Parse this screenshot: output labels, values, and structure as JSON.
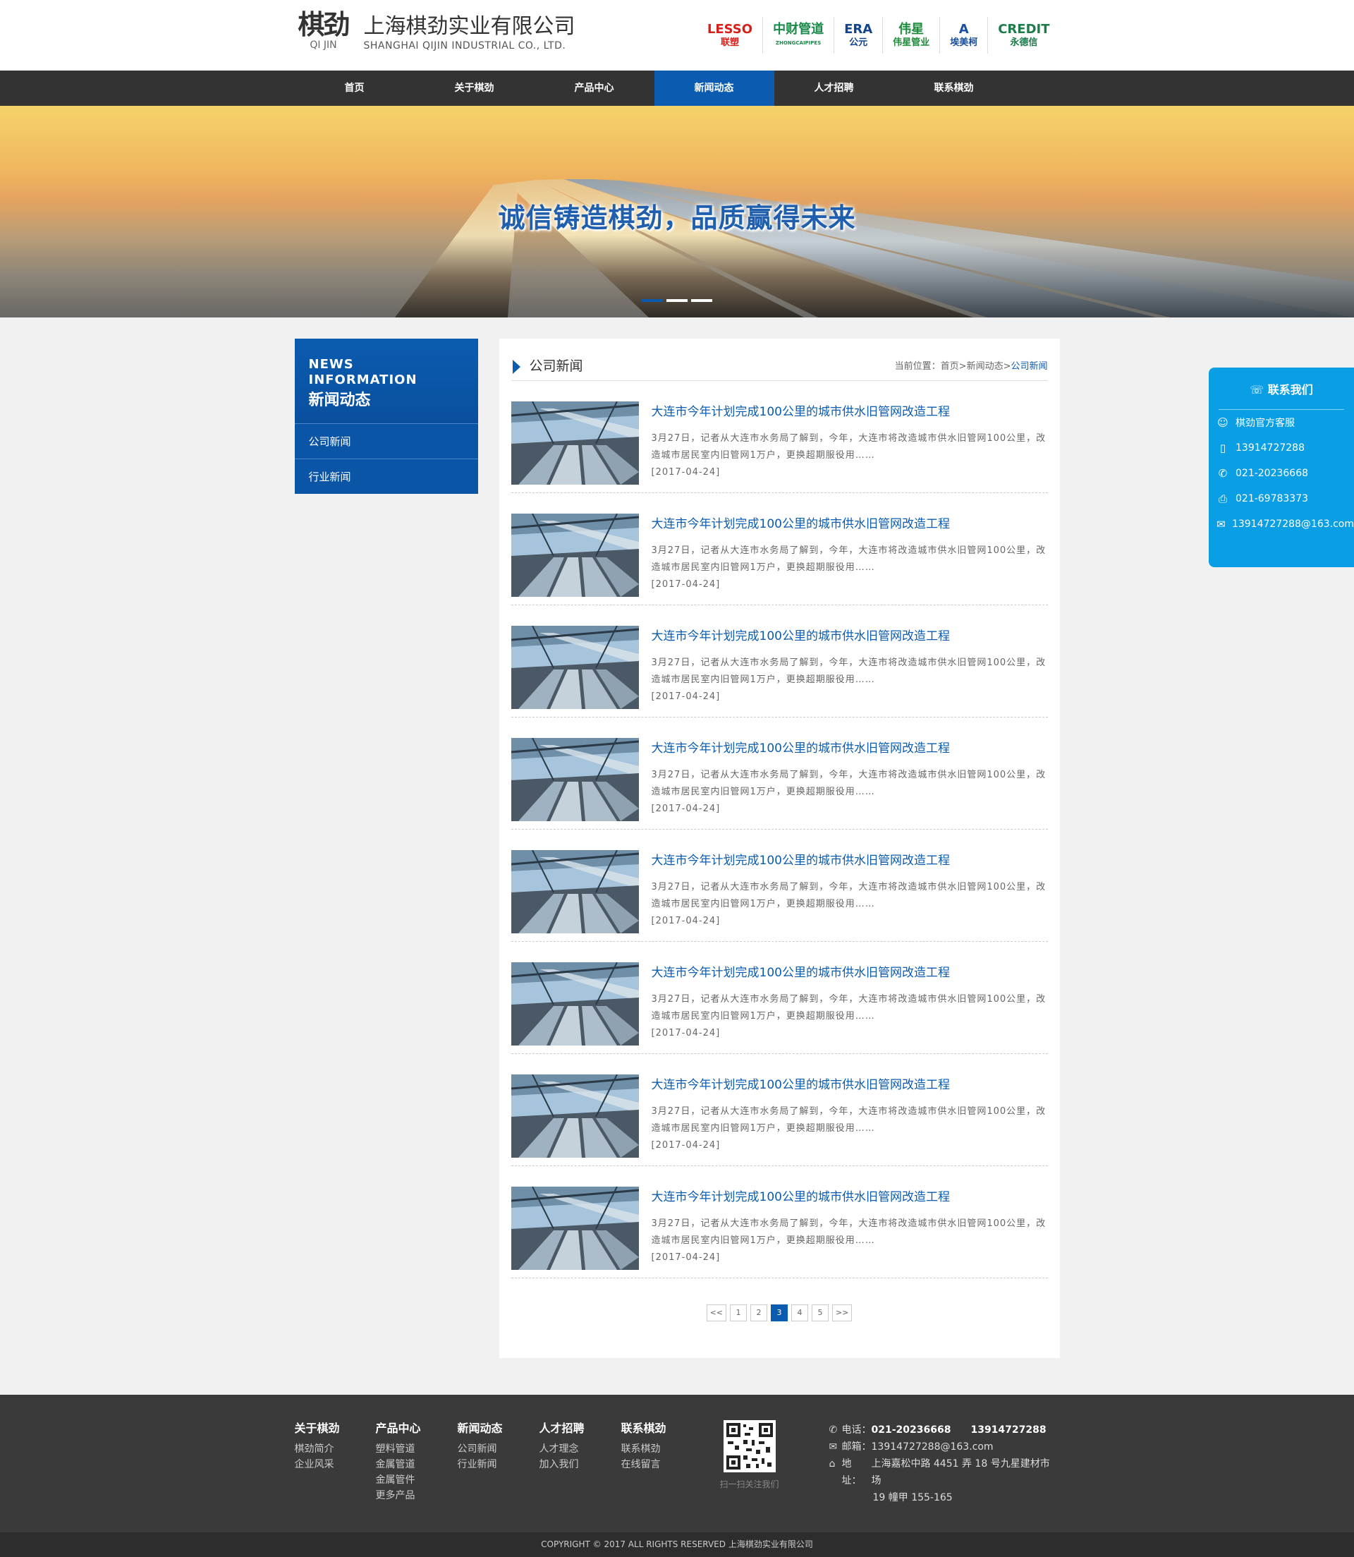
{
  "brand": {
    "logo_mark": "棋劲",
    "logo_sub": "QI JIN",
    "company_cn": "上海棋劲实业有限公司",
    "company_en": "SHANGHAI QIJIN INDUSTRIAL CO., LTD."
  },
  "partners": [
    {
      "main": "LESSO",
      "sub": "联塑",
      "color": "#d6201b"
    },
    {
      "main": "中财管道",
      "sub": "ZHONGCAIPIPES",
      "color": "#1a8a4a"
    },
    {
      "main": "ERA",
      "sub": "公元",
      "color": "#12438f"
    },
    {
      "main": "伟星",
      "sub": "伟星管业",
      "color": "#1e8c3a"
    },
    {
      "main": "A",
      "sub": "埃美柯",
      "color": "#1b4fa0"
    },
    {
      "main": "CREDIT",
      "sub": "永德信",
      "color": "#1b7b4a"
    }
  ],
  "nav": [
    {
      "label": "首页",
      "active": false
    },
    {
      "label": "关于棋劲",
      "active": false
    },
    {
      "label": "产品中心",
      "active": false
    },
    {
      "label": "新闻动态",
      "active": true
    },
    {
      "label": "人才招聘",
      "active": false
    },
    {
      "label": "联系棋劲",
      "active": false
    }
  ],
  "banner": {
    "slogan": "诚信铸造棋劲，品质赢得未来",
    "slides": 3,
    "active_slide": 0
  },
  "sidebar": {
    "title_en": "NEWS INFORMATION",
    "title_cn": "新闻动态",
    "items": [
      "公司新闻",
      "行业新闻"
    ]
  },
  "content": {
    "title": "公司新闻",
    "breadcrumb_label": "当前位置：",
    "breadcrumb": [
      "首页",
      "新闻动态",
      "公司新闻"
    ],
    "separator": ">"
  },
  "news": [
    {
      "title": "大连市今年计划完成100公里的城市供水旧管网改造工程",
      "desc": "3月27日，记者从大连市水务局了解到，今年，大连市将改造城市供水旧管网100公里，改造城市居民室内旧管网1万户，更换超期服役用……",
      "date": "[2017-04-24]"
    },
    {
      "title": "大连市今年计划完成100公里的城市供水旧管网改造工程",
      "desc": "3月27日，记者从大连市水务局了解到，今年，大连市将改造城市供水旧管网100公里，改造城市居民室内旧管网1万户，更换超期服役用……",
      "date": "[2017-04-24]"
    },
    {
      "title": "大连市今年计划完成100公里的城市供水旧管网改造工程",
      "desc": "3月27日，记者从大连市水务局了解到，今年，大连市将改造城市供水旧管网100公里，改造城市居民室内旧管网1万户，更换超期服役用……",
      "date": "[2017-04-24]"
    },
    {
      "title": "大连市今年计划完成100公里的城市供水旧管网改造工程",
      "desc": "3月27日，记者从大连市水务局了解到，今年，大连市将改造城市供水旧管网100公里，改造城市居民室内旧管网1万户，更换超期服役用……",
      "date": "[2017-04-24]"
    },
    {
      "title": "大连市今年计划完成100公里的城市供水旧管网改造工程",
      "desc": "3月27日，记者从大连市水务局了解到，今年，大连市将改造城市供水旧管网100公里，改造城市居民室内旧管网1万户，更换超期服役用……",
      "date": "[2017-04-24]"
    },
    {
      "title": "大连市今年计划完成100公里的城市供水旧管网改造工程",
      "desc": "3月27日，记者从大连市水务局了解到，今年，大连市将改造城市供水旧管网100公里，改造城市居民室内旧管网1万户，更换超期服役用……",
      "date": "[2017-04-24]"
    },
    {
      "title": "大连市今年计划完成100公里的城市供水旧管网改造工程",
      "desc": "3月27日，记者从大连市水务局了解到，今年，大连市将改造城市供水旧管网100公里，改造城市居民室内旧管网1万户，更换超期服役用……",
      "date": "[2017-04-24]"
    },
    {
      "title": "大连市今年计划完成100公里的城市供水旧管网改造工程",
      "desc": "3月27日，记者从大连市水务局了解到，今年，大连市将改造城市供水旧管网100公里，改造城市居民室内旧管网1万户，更换超期服役用……",
      "date": "[2017-04-24]"
    }
  ],
  "pagination": {
    "prev": "<<",
    "next": ">>",
    "pages": [
      "1",
      "2",
      "3",
      "4",
      "5"
    ],
    "current": "3"
  },
  "float_contact": {
    "title": "联系我们",
    "rows": [
      {
        "icon": "qq-icon",
        "glyph": "☺",
        "text": "棋劲官方客服"
      },
      {
        "icon": "mobile-icon",
        "glyph": "▯",
        "text": "13914727288"
      },
      {
        "icon": "phone-icon",
        "glyph": "✆",
        "text": "021-20236668"
      },
      {
        "icon": "fax-icon",
        "glyph": "⎙",
        "text": "021-69783373"
      },
      {
        "icon": "mail-icon",
        "glyph": "✉",
        "text": "13914727288@163.com"
      }
    ]
  },
  "footer": {
    "columns": [
      {
        "title": "关于棋劲",
        "items": [
          "棋劲简介",
          "企业风采"
        ]
      },
      {
        "title": "产品中心",
        "items": [
          "塑料管道",
          "金属管道",
          "金属管件",
          "更多产品"
        ]
      },
      {
        "title": "新闻动态",
        "items": [
          "公司新闻",
          "行业新闻"
        ]
      },
      {
        "title": "人才招聘",
        "items": [
          "人才理念",
          "加入我们"
        ]
      },
      {
        "title": "联系棋劲",
        "items": [
          "联系棋劲",
          "在线留言"
        ]
      }
    ],
    "qr_caption": "扫一扫关注我们",
    "phone_label": "电话：",
    "phone": "021-20236668　　13914727288",
    "email_label": "邮箱：",
    "email": "13914727288@163.com",
    "address_label": "地址：",
    "address_line1": "上海嘉松中路 4451 弄 18 号九星建材市场",
    "address_line2": "19 幢甲 155-165",
    "copyright": "COPYRIGHT © 2017 ALL RIGHTS RESERVED 上海棋劲实业有限公司"
  }
}
